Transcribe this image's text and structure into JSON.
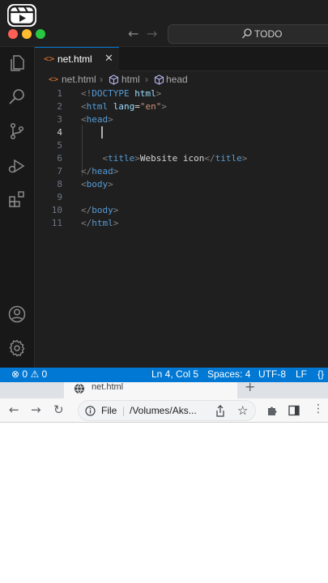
{
  "vscode": {
    "command_center": {
      "label": "TODO"
    },
    "tab": {
      "label": "net.html",
      "icon": "html-file-icon"
    },
    "breadcrumb": {
      "file": "net.html",
      "seg1": "html",
      "seg2": "head"
    },
    "lines": [
      {
        "n": "1",
        "tokens": [
          [
            "bracket",
            "<!"
          ],
          [
            "tag",
            "DOCTYPE "
          ],
          [
            "attr",
            "html"
          ],
          [
            "bracket",
            ">"
          ]
        ]
      },
      {
        "n": "2",
        "tokens": [
          [
            "bracket",
            "<"
          ],
          [
            "tag",
            "html "
          ],
          [
            "attr",
            "lang"
          ],
          [
            "text",
            "="
          ],
          [
            "str",
            "\"en\""
          ],
          [
            "bracket",
            ">"
          ]
        ]
      },
      {
        "n": "3",
        "tokens": [
          [
            "bracket",
            "<"
          ],
          [
            "tag",
            "head"
          ],
          [
            "bracket",
            ">"
          ]
        ]
      },
      {
        "n": "4",
        "tokens": []
      },
      {
        "n": "5",
        "tokens": []
      },
      {
        "n": "6",
        "tokens": [
          [
            "text",
            "    "
          ],
          [
            "bracket",
            "<"
          ],
          [
            "tag",
            "title"
          ],
          [
            "bracket",
            ">"
          ],
          [
            "text",
            "Website icon"
          ],
          [
            "bracket",
            "</"
          ],
          [
            "tag",
            "title"
          ],
          [
            "bracket",
            ">"
          ]
        ]
      },
      {
        "n": "7",
        "tokens": [
          [
            "bracket",
            "</"
          ],
          [
            "tag",
            "head"
          ],
          [
            "bracket",
            ">"
          ]
        ]
      },
      {
        "n": "8",
        "tokens": [
          [
            "bracket",
            "<"
          ],
          [
            "tag",
            "body"
          ],
          [
            "bracket",
            ">"
          ]
        ]
      },
      {
        "n": "9",
        "tokens": []
      },
      {
        "n": "10",
        "tokens": [
          [
            "bracket",
            "</"
          ],
          [
            "tag",
            "body"
          ],
          [
            "bracket",
            ">"
          ]
        ]
      },
      {
        "n": "11",
        "tokens": [
          [
            "bracket",
            "</"
          ],
          [
            "tag",
            "html"
          ],
          [
            "bracket",
            ">"
          ]
        ]
      }
    ],
    "active_line": "4",
    "status": {
      "errors": "0",
      "warnings": "0",
      "position": "Ln 4, Col 5",
      "spaces": "Spaces: 4",
      "encoding": "UTF-8",
      "eol": "LF"
    },
    "colors": {
      "statusbar": "#0078d4",
      "tag": "#569cd6",
      "attr": "#9cdcfe",
      "string": "#ce9178"
    }
  },
  "chrome": {
    "tab": {
      "label": "net.html",
      "icon": "globe-icon"
    },
    "new_tab": "+",
    "omnibox": {
      "scheme": "File",
      "path": "/Volumes/Aks..."
    }
  }
}
